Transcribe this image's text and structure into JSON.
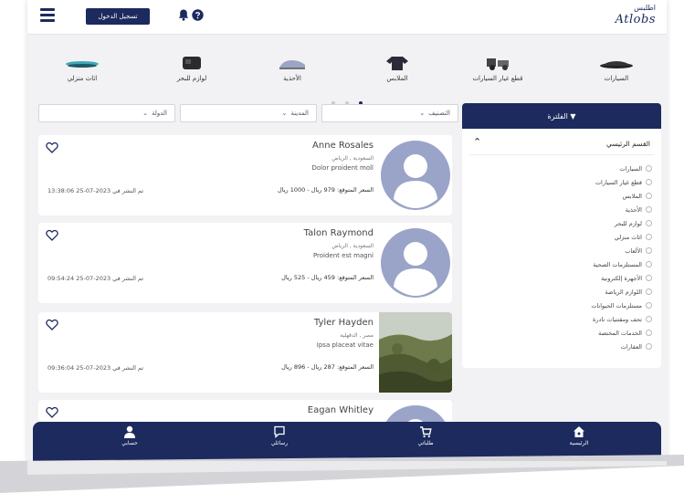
{
  "header": {
    "login_label": "تسجيل الدخول",
    "logo_ar": "اطلبس",
    "logo_en": "Atlobs"
  },
  "categories": [
    {
      "label": "السيارات",
      "icon": "car-icon"
    },
    {
      "label": "قطع غيار السيارات",
      "icon": "car-parts-icon"
    },
    {
      "label": "الملابس",
      "icon": "clothes-icon"
    },
    {
      "label": "الأحذية",
      "icon": "shoes-icon"
    },
    {
      "label": "لوازم للبحر",
      "icon": "sea-gear-icon"
    },
    {
      "label": "اثاث منزلي",
      "icon": "furniture-icon"
    }
  ],
  "filters": {
    "classification": "التصنيف",
    "city": "المدينة",
    "country": "الدولة"
  },
  "sidebar": {
    "header_label": "▼ الفلترة",
    "section_title": "القسم الرئيسي",
    "items": [
      "السيارات",
      "قطع غيار السيارات",
      "الملابس",
      "الأحذية",
      "لوازم للبحر",
      "اثاث منزلي",
      "الألعاب",
      "المستلزمات الصحية",
      "الأجهزة إلكترونية",
      "اللوازم الرياضة",
      "مستلزمات الحيوانات",
      "تحف ومقتنيات نادرة",
      "الخدمات المختصة",
      "العقارات"
    ]
  },
  "listings": [
    {
      "name": "Anne Rosales",
      "location": "السعودية , الرياض",
      "description": "Dolor proident moll",
      "price": "السعر المتوقع: 979 ريال - 1000 ريال",
      "date": "تم النشر في 2023-07-25 13:38:06",
      "image": "avatar"
    },
    {
      "name": "Talon Raymond",
      "location": "السعودية , الرياض",
      "description": "Proident est magni",
      "price": "السعر المتوقع: 459 ريال - 525 ريال",
      "date": "تم النشر في 2023-07-25 09:54:24",
      "image": "avatar"
    },
    {
      "name": "Tyler Hayden",
      "location": "مصر , الدقهلية",
      "description": "Ipsa placeat vitae",
      "price": "السعر المتوقع: 287 ريال - 896 ريال",
      "date": "تم النشر في 2023-07-25 09:36:04",
      "image": "landscape"
    },
    {
      "name": "Eagan Whitley",
      "location": "",
      "description": "",
      "price": "",
      "date": "",
      "image": "avatar"
    }
  ],
  "bottom_nav": [
    {
      "label": "حسابي",
      "icon": "user-icon"
    },
    {
      "label": "رسائلي",
      "icon": "chat-icon"
    },
    {
      "label": "طلباتي",
      "icon": "cart-icon"
    },
    {
      "label": "الرئيسية",
      "icon": "home-icon"
    }
  ],
  "colors": {
    "primary": "#1c2a5e",
    "background": "#f2f2f4",
    "avatar_bg": "#9aa4c8"
  }
}
